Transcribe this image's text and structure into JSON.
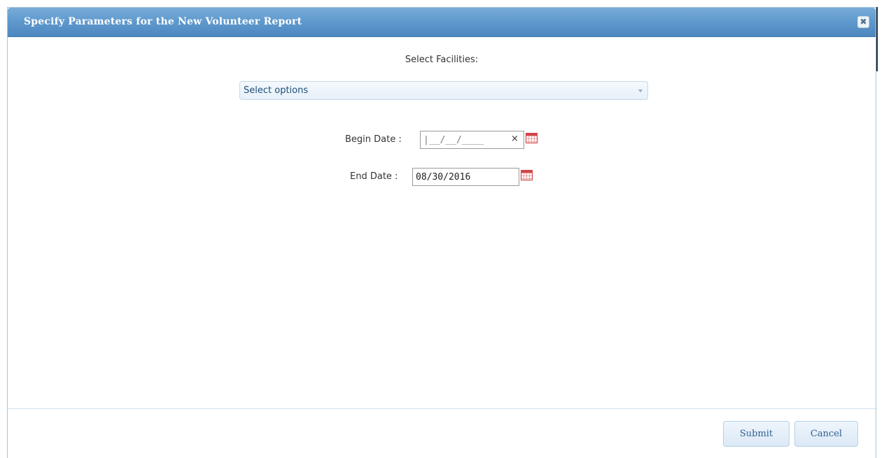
{
  "dialog": {
    "title": "Specify Parameters for the New Volunteer Report",
    "close_glyph": "✖"
  },
  "facilities": {
    "label": "Select Facilities:",
    "selected_text": "Select options"
  },
  "begin_date": {
    "label": "Begin Date :",
    "value": "|__/__/____",
    "clear_glyph": "×"
  },
  "end_date": {
    "label": "End Date :",
    "value": "08/30/2016"
  },
  "buttons": {
    "submit": "Submit",
    "cancel": "Cancel"
  },
  "icons": {
    "close": "close-icon",
    "dropdown": "chevron-down-icon",
    "calendar": "calendar-icon",
    "clear": "clear-icon"
  },
  "colors": {
    "titlebar": "#5e98cc",
    "button_text": "#2f5f8f",
    "select_text": "#1f4d78",
    "calendar_red": "#cf3b3b"
  }
}
